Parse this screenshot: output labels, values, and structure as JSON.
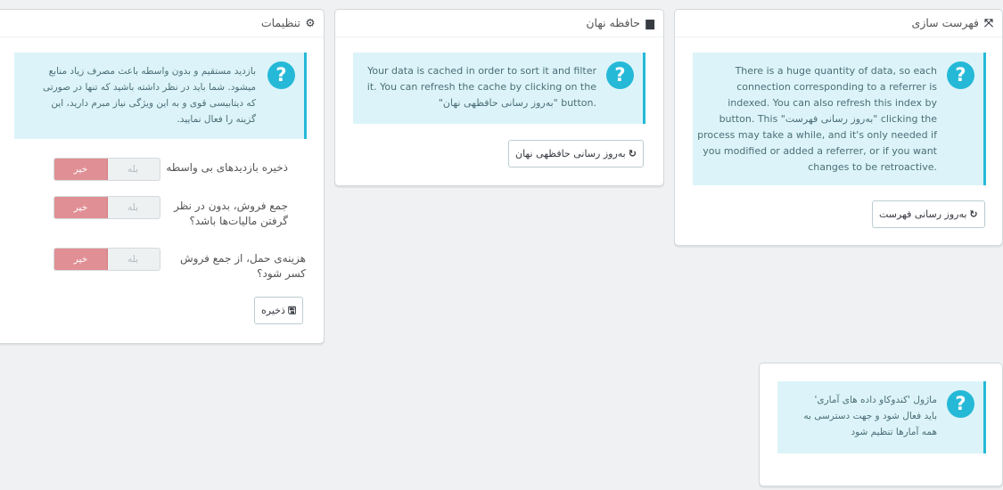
{
  "settings_panel": {
    "title": "تنظیمات",
    "info": "بازدید مستقیم و بدون واسطه باعث مصرف زیاد منابع\nمیشود. شما باید در نظر داشته باشید که تنها در صورتی\nکه دیتابیسی قوی و به این ویژگی نیاز مبرم دارید، این\nگزینه را فعال نمایید.",
    "rows": [
      {
        "label": "ذخیره بازدیدهای بی واسطه",
        "yes": "بله",
        "no": "خیر",
        "value": "no"
      },
      {
        "label": "جمع فروش، بدون در نظر\nگرفتن مالیات‌ها باشد؟",
        "yes": "بله",
        "no": "خیر",
        "value": "no"
      },
      {
        "label": "هزینه‌ی حمل، از جمع فروش\nکسر شود؟",
        "yes": "بله",
        "no": "خیر",
        "value": "no"
      }
    ],
    "save_label": "ذخیره"
  },
  "cache_panel": {
    "title": "حافظه نهان",
    "info": "Your data is cached in order to sort it and filter\nit. You can refresh the cache by clicking on the\n\"به‌روز رسانی حافظهی نهان\" button.",
    "button_label": "به‌روز رسانی حافظهی نهان"
  },
  "index_panel": {
    "title": "فهرست سازی",
    "info": "There is a huge quantity of data, so each\nconnection corresponding to a referrer is\nindexed. You can also refresh this index by\nbutton. This \"به‌روز رسانی فهرست\" clicking the\nprocess may take a while, and it's only needed if\nyou modified or added a referrer, or if you want\nchanges to be retroactive.",
    "button_label": "به‌روز رسانی فهرست"
  },
  "module_panel": {
    "info": "ماژول 'کندوکاو داده های آماری'\nباید فعال شود و جهت دسترسی به\nهمه آمارها تنظیم شود"
  },
  "colors": {
    "info_bg": "#dcf4f9",
    "info_accent": "#25b9d7",
    "switch_no": "#e08f95"
  },
  "icons": {
    "settings": "gear-icon",
    "cache": "briefcase-icon",
    "index": "expand-icon",
    "help": "question-circle-icon",
    "refresh": "refresh-icon",
    "save": "floppy-icon"
  }
}
